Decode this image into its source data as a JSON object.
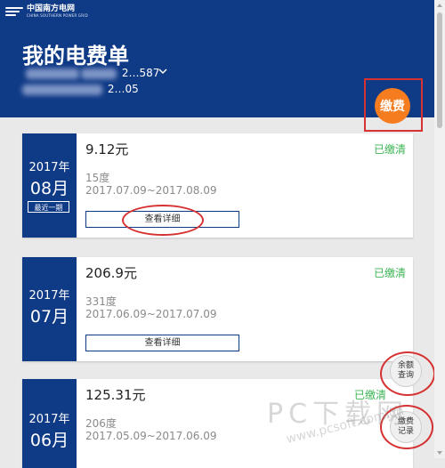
{
  "brand": {
    "name_cn": "中国南方电网",
    "name_en": "CHINA SOUTHERN POWER GRID"
  },
  "header": {
    "title": "我的电费单",
    "account_line1_visible": "2…587",
    "account_line2_visible": "2…05",
    "pay_label": "缴费"
  },
  "bills": [
    {
      "year": "2017年",
      "month": "08月",
      "tag": "最近一期",
      "amount": "9.12元",
      "status": "已缴清",
      "usage": "15度",
      "period": "2017.07.09~2017.08.09",
      "detail_label": "查看详细"
    },
    {
      "year": "2017年",
      "month": "07月",
      "tag": "",
      "amount": "206.9元",
      "status": "已缴清",
      "usage": "331度",
      "period": "2017.06.09~2017.07.09",
      "detail_label": "查看详细"
    },
    {
      "year": "2017年",
      "month": "06月",
      "tag": "",
      "amount": "125.31元",
      "status": "已缴清",
      "usage": "206度",
      "period": "2017.05.09~2017.06.09",
      "detail_label": ""
    }
  ],
  "floating": {
    "balance_line1": "余额",
    "balance_line2": "查询",
    "records_line1": "缴费",
    "records_line2": "记录"
  },
  "watermark": {
    "big": "PC下载网",
    "small": "www.pcsoft.com.cn"
  },
  "colors": {
    "primary": "#0f3a86",
    "accent": "#f57c1f",
    "paid": "#3cb454",
    "annotation": "#d63232"
  }
}
